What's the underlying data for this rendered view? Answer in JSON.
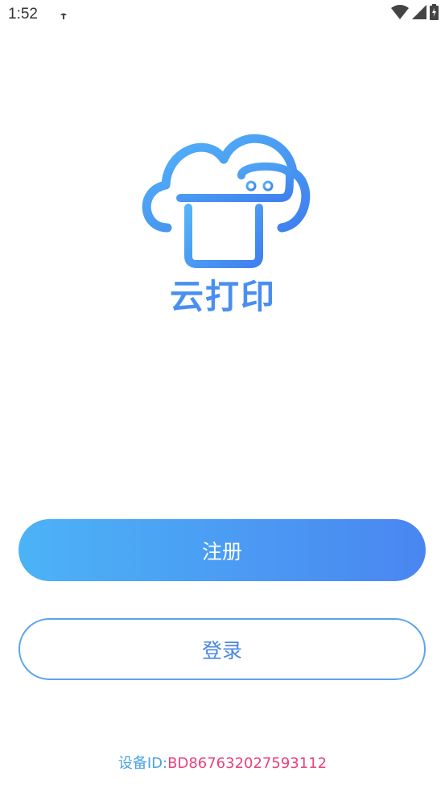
{
  "status_bar": {
    "time": "1:52",
    "icons": [
      "notification-icon",
      "wifi-icon",
      "signal-icon",
      "battery-icon"
    ]
  },
  "logo": {
    "text": "云打印",
    "icon": "cloud-printer-icon",
    "color": "#4a90ef"
  },
  "buttons": {
    "register_label": "注册",
    "login_label": "登录"
  },
  "device": {
    "label": "设备ID:",
    "value": "BD867632027593112"
  },
  "colors": {
    "gradient_start": "#4cb3f6",
    "gradient_end": "#4a86f1",
    "device_value": "#e8437a"
  }
}
